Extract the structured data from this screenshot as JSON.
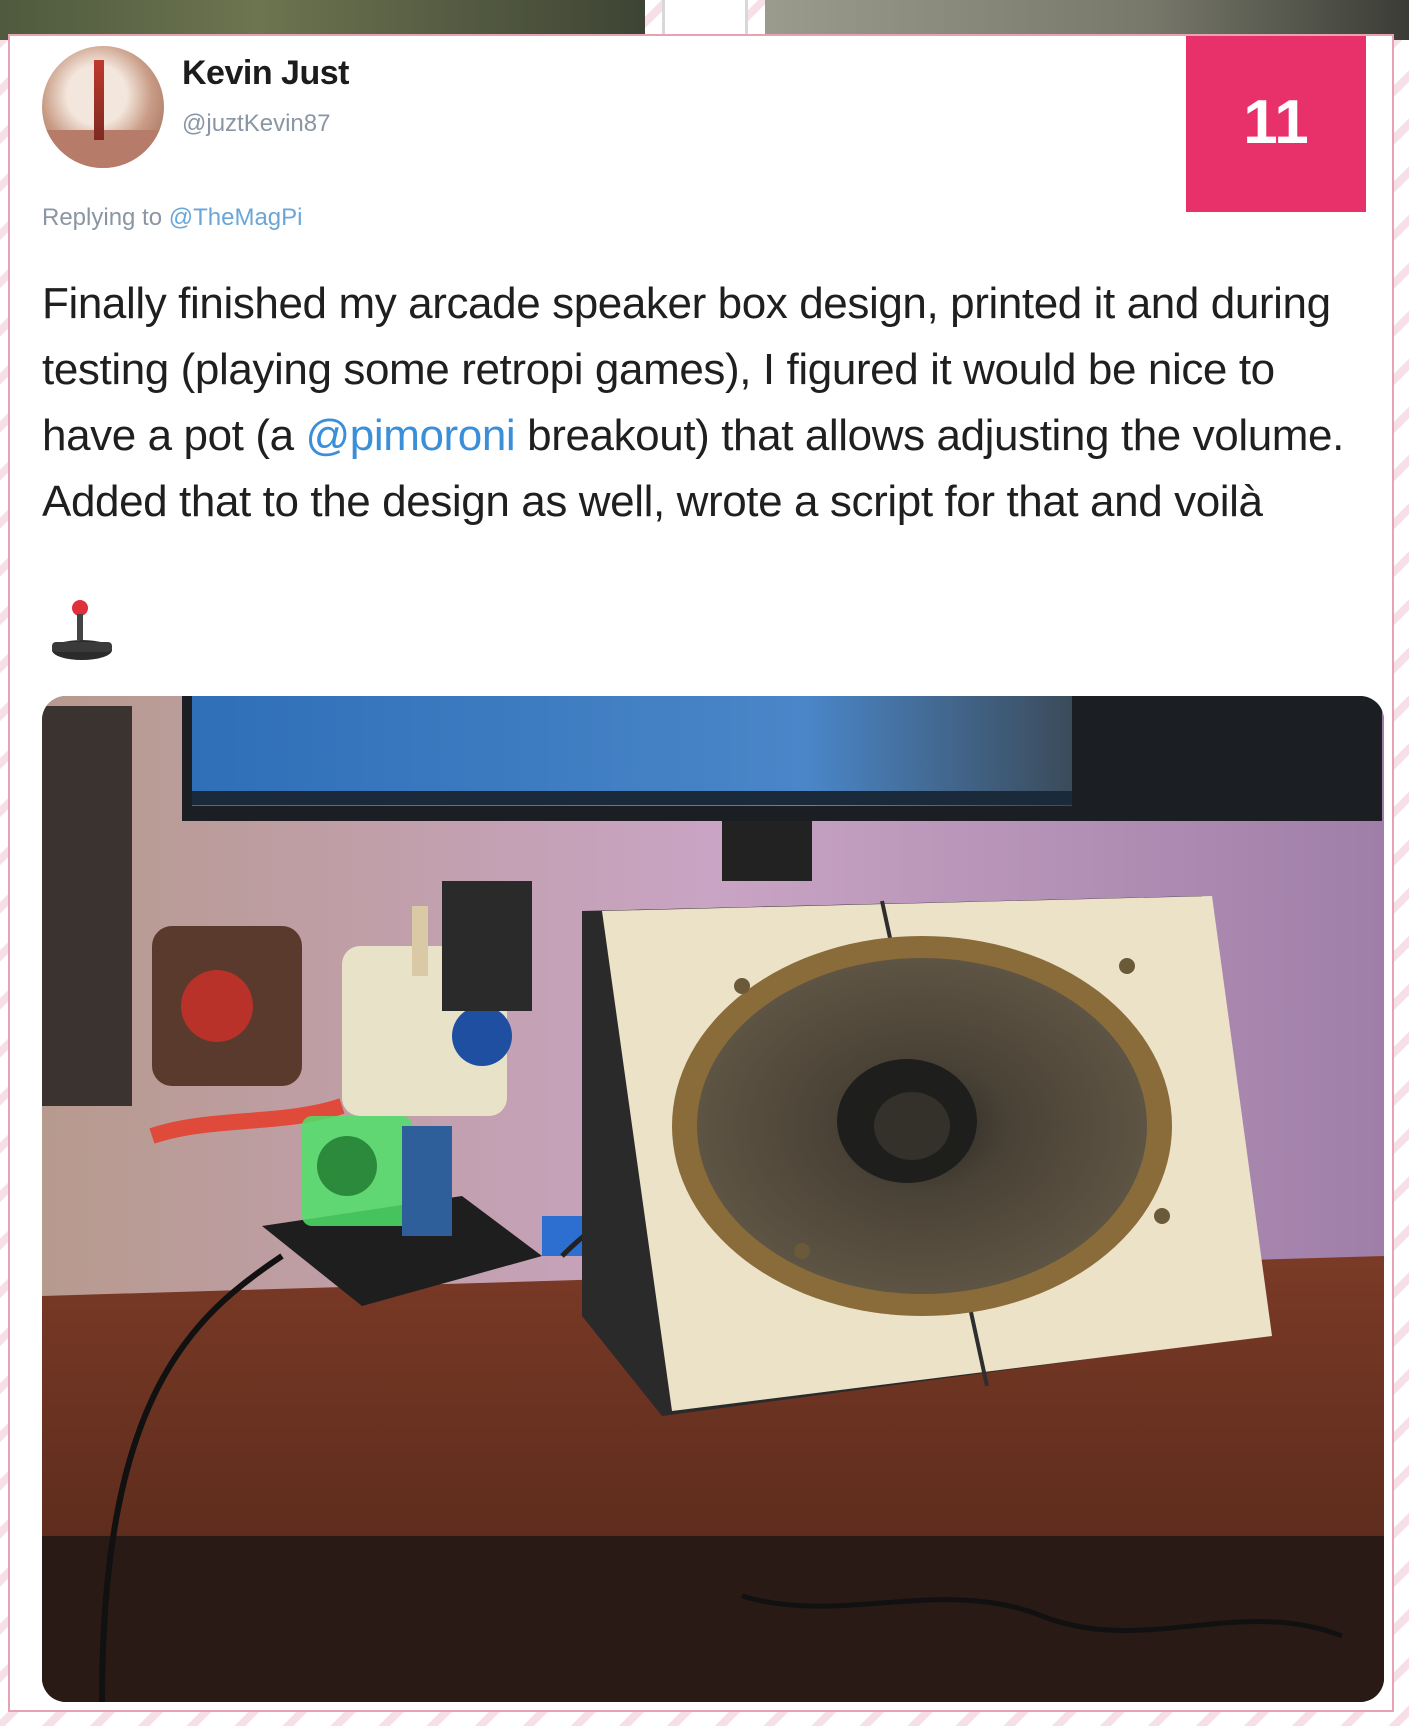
{
  "issue_number": "11",
  "tweet": {
    "author_name": "Kevin Just",
    "author_handle": "@juztKevin87",
    "reply_prefix": "Replying to",
    "reply_to": "@TheMagPi",
    "text_part1": "Finally finished my arcade speaker box design, printed it and during testing (playing some retropi games), I figured it would be nice to have a pot (a ",
    "text_mention": "@pimoroni",
    "text_part2": " breakout) that allows adjusting the volume. Added that to the design as well, wrote a script for that and voilà",
    "emoji_icon": "joystick-icon",
    "photo_icon": "speaker-box-photo"
  },
  "colors": {
    "badge": "#e8306a",
    "mention": "#3b8fd9",
    "card_border": "#e6a3b4"
  }
}
